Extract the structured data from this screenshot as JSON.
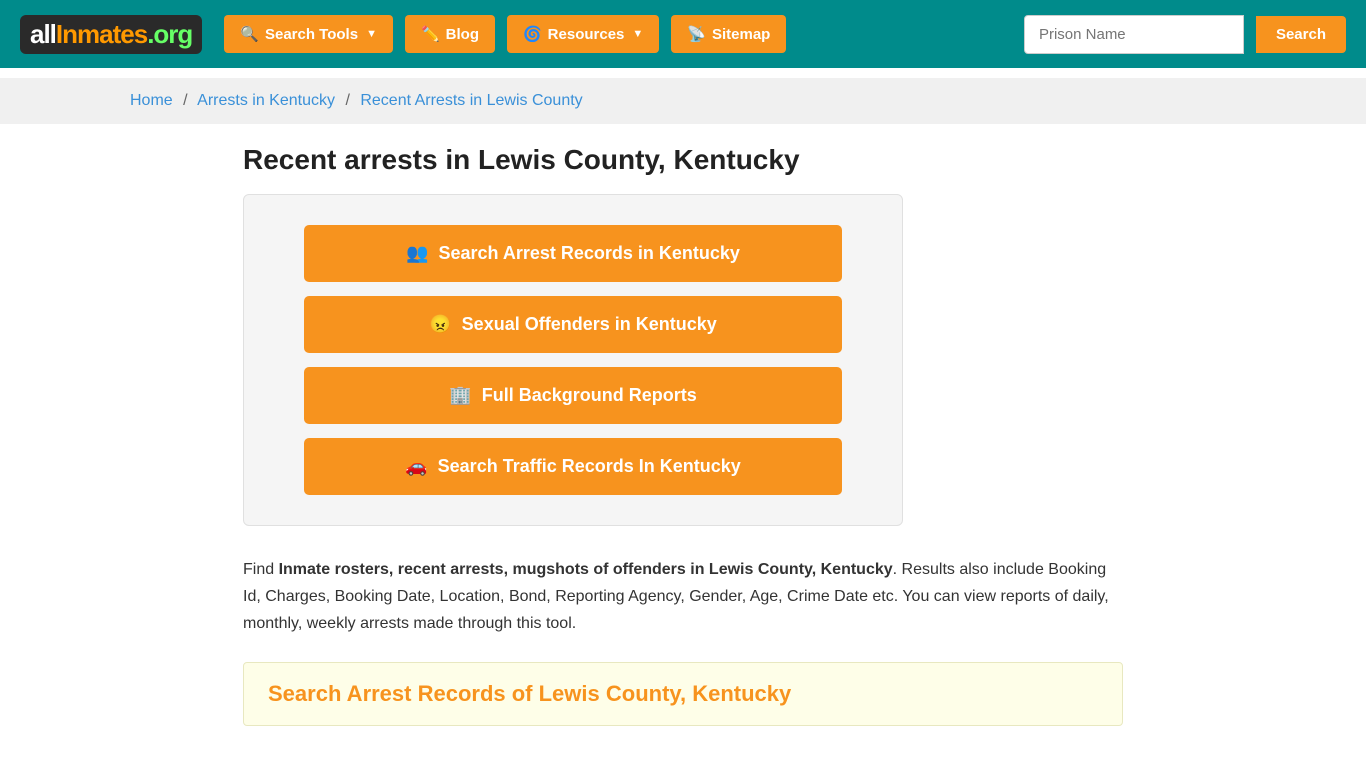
{
  "site": {
    "logo_all": "all",
    "logo_inmates": "Inmates",
    "logo_org": ".org"
  },
  "header": {
    "nav": [
      {
        "id": "search-tools",
        "label": "Search Tools",
        "has_caret": true,
        "icon": "🔍"
      },
      {
        "id": "blog",
        "label": "Blog",
        "has_caret": false,
        "icon": "✏️"
      },
      {
        "id": "resources",
        "label": "Resources",
        "has_caret": true,
        "icon": "🌀"
      },
      {
        "id": "sitemap",
        "label": "Sitemap",
        "has_caret": false,
        "icon": "📡"
      }
    ],
    "search_placeholder": "Prison Name",
    "search_button_label": "Search"
  },
  "breadcrumb": {
    "home": "Home",
    "level1": "Arrests in Kentucky",
    "level2": "Recent Arrests in Lewis County"
  },
  "page": {
    "title": "Recent arrests in Lewis County, Kentucky",
    "action_buttons": [
      {
        "id": "arrest-records",
        "icon": "👥",
        "label": "Search Arrest Records in Kentucky"
      },
      {
        "id": "sex-offenders",
        "icon": "😠",
        "label": "Sexual Offenders in Kentucky"
      },
      {
        "id": "background-reports",
        "icon": "🏢",
        "label": "Full Background Reports"
      },
      {
        "id": "traffic-records",
        "icon": "🚗",
        "label": "Search Traffic Records In Kentucky"
      }
    ],
    "description_intro": "Find ",
    "description_bold": "Inmate rosters, recent arrests, mugshots of offenders in Lewis County, Kentucky",
    "description_rest": ". Results also include Booking Id, Charges, Booking Date, Location, Bond, Reporting Agency, Gender, Age, Crime Date etc. You can view reports of daily, monthly, weekly arrests made through this tool.",
    "search_section_title": "Search Arrest Records of Lewis County, Kentucky"
  }
}
